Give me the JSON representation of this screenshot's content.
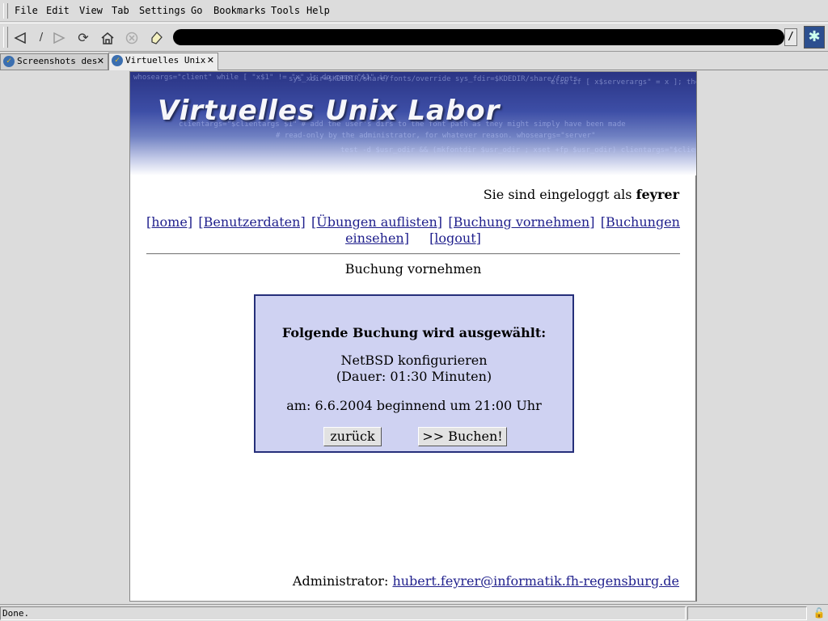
{
  "menu": [
    "File",
    "Edit",
    "View",
    "Tab",
    "Settings",
    "Go",
    "Bookmarks",
    "Tools",
    "Help"
  ],
  "toolbar": {
    "back_icon": "back-arrow-icon",
    "forward_icon": "forward-arrow-icon",
    "reload_icon": "reload-icon",
    "home_icon": "home-icon",
    "stop_icon": "stop-icon",
    "bookmark_icon": "bookmark-icon",
    "url": ""
  },
  "tabs": [
    {
      "label": "Screenshots des",
      "active": false
    },
    {
      "label": "Virtuelles Unix",
      "active": true
    }
  ],
  "page": {
    "banner_title": "Virtuelles Unix Labor",
    "login_prefix": "Sie sind eingeloggt als ",
    "login_user": "feyrer",
    "nav": {
      "home": "[home]",
      "userdata": "[Benutzerdaten]",
      "exercises": "[Übungen auflisten]",
      "make_booking": "[Buchung vornehmen]",
      "view_bookings_1": "[Buchungen",
      "view_bookings_2": "einsehen]",
      "logout": "[logout]"
    },
    "heading": "Buchung vornehmen",
    "box": {
      "title": "Folgende Buchung wird ausgewählt:",
      "course": "NetBSD konfigurieren",
      "duration": "(Dauer: 01:30 Minuten)",
      "date": "am: 6.6.2004 beginnend um 21:00 Uhr",
      "back_button": "zurück",
      "book_button": ">> Buchen!"
    },
    "admin_label": "Administrator: ",
    "admin_email": "hubert.feyrer@informatik.fh-regensburg.de"
  },
  "status": {
    "text": "Done."
  },
  "colors": {
    "banner": "#3d4ea6",
    "link": "#1f1f8c",
    "box_bg": "#cfd2f2",
    "box_border": "#262f7a"
  }
}
